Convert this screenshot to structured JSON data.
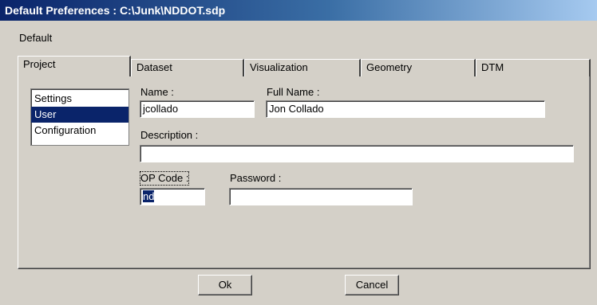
{
  "window": {
    "title": "Default Preferences : C:\\Junk\\NDDOT.sdp"
  },
  "menu": {
    "default_label": "Default"
  },
  "tabs": [
    "Project",
    "Dataset",
    "Visualization",
    "Geometry",
    "DTM"
  ],
  "project": {
    "list_items": [
      "Settings",
      "User",
      "Configuration"
    ],
    "selected_item": "User"
  },
  "user_form": {
    "name_label": "Name :",
    "name_value": "jcollado",
    "fullname_label": "Full Name :",
    "fullname_value": "Jon Collado",
    "description_label": "Description :",
    "description_value": "",
    "opcode_label": "OP Code :",
    "opcode_value": "nd",
    "password_label": "Password :",
    "password_value": ""
  },
  "buttons": {
    "ok": "Ok",
    "cancel": "Cancel"
  }
}
